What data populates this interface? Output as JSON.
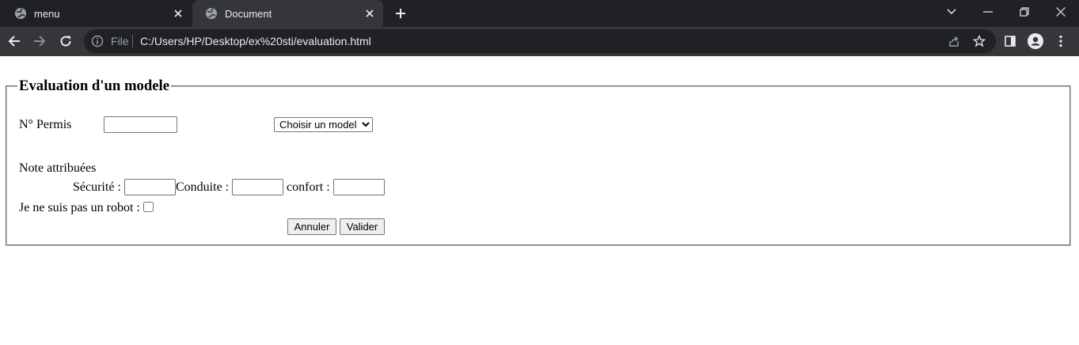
{
  "browser": {
    "tabs": [
      {
        "title": "menu",
        "icon": "globe-icon",
        "active": false
      },
      {
        "title": "Document",
        "icon": "globe-icon",
        "active": true
      }
    ],
    "address": {
      "scheme_label": "File",
      "url": "C:/Users/HP/Desktop/ex%20sti/evaluation.html"
    },
    "colors": {
      "tabbar": "#202124",
      "toolbar": "#35363a",
      "text": "#e8eaed"
    }
  },
  "form": {
    "legend": "Evaluation d'un modele",
    "permis_label": "N° Permis",
    "permis_value": "",
    "model_select": {
      "selected": "Choisir un model",
      "options": [
        "Choisir un model"
      ]
    },
    "notes_heading": "Note attribuées",
    "securite_label": "Sécurité :",
    "securite_value": "",
    "conduite_label": "Conduite :",
    "conduite_value": "",
    "confort_label": "confort :",
    "confort_value": "",
    "robot_label": "Je ne suis pas un robot :",
    "robot_checked": false,
    "cancel_label": "Annuler",
    "submit_label": "Valider"
  }
}
